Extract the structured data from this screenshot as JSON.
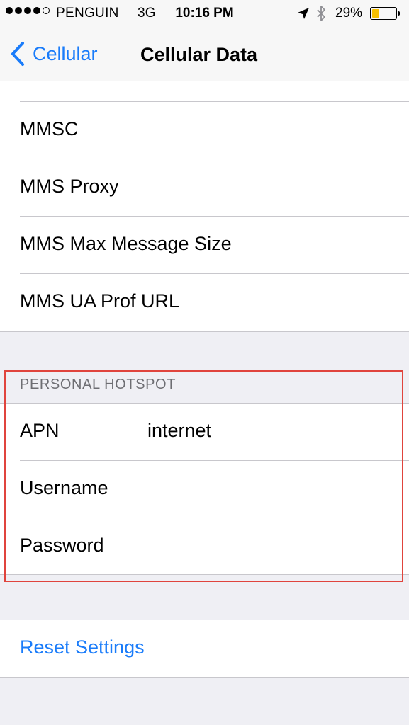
{
  "status_bar": {
    "carrier": "PENGUIN",
    "network": "3G",
    "time": "10:16 PM",
    "battery_percent": "29%",
    "battery_color": "#f6c000",
    "signal_icon": "signal-dots-icon",
    "location_icon": "location-arrow-icon",
    "bluetooth_icon": "bluetooth-icon"
  },
  "nav": {
    "back_label": "Cellular",
    "title": "Cellular Data",
    "accent_color": "#1a7cfa"
  },
  "mms_rows": [
    {
      "label": "MMSC",
      "value": ""
    },
    {
      "label": "MMS Proxy",
      "value": ""
    },
    {
      "label": "MMS Max Message Size",
      "value": ""
    },
    {
      "label": "MMS UA Prof URL",
      "value": ""
    }
  ],
  "hotspot": {
    "header": "PERSONAL HOTSPOT",
    "rows": [
      {
        "label": "APN",
        "value": "internet"
      },
      {
        "label": "Username",
        "value": ""
      },
      {
        "label": "Password",
        "value": ""
      }
    ],
    "highlight_color": "#e0443d"
  },
  "reset": {
    "label": "Reset Settings"
  }
}
